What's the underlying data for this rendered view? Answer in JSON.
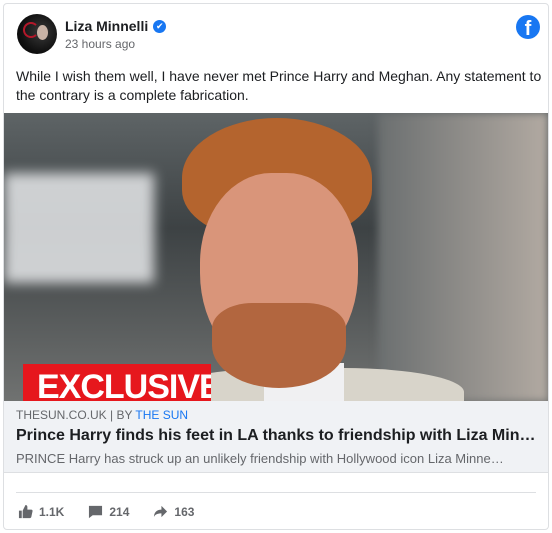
{
  "header": {
    "name": "Liza Minnelli",
    "verified_mark": "✔",
    "time": "23 hours ago",
    "platform_logo_letter": "f"
  },
  "post": {
    "text": "While I wish them well, I have never met Prince Harry and Meghan. Any statement to the contrary is a complete fabrication."
  },
  "photo": {
    "overlay_text": "EXCLUSIVE"
  },
  "link": {
    "domain": "THESUN.CO.UK",
    "separator": " | BY ",
    "publisher": "THE SUN",
    "title": "Prince Harry finds his feet in LA thanks to friendship with Liza Min…",
    "description": "PRINCE Harry has struck up an unlikely friendship with Hollywood icon Liza Minne…"
  },
  "stats": {
    "likes": "1.1K",
    "comments": "214",
    "shares": "163"
  },
  "icons": {
    "like": "thumbs-up-icon",
    "comment": "comment-bubble-icon",
    "share": "share-arrow-icon"
  },
  "colors": {
    "brand_blue": "#1877f2",
    "exclusive_red": "#e6171d",
    "link_box_bg": "#f0f2f5"
  }
}
